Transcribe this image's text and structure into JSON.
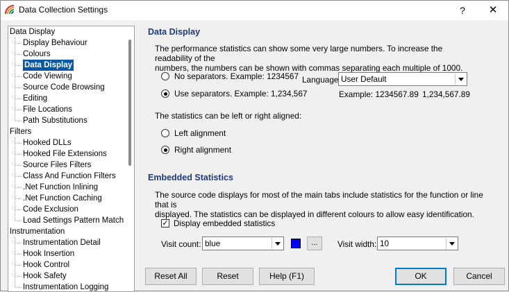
{
  "window": {
    "title": "Data Collection Settings",
    "help_glyph": "?",
    "close_glyph": "✕"
  },
  "tree": {
    "groups": [
      {
        "label": "Data Display",
        "children": [
          "Display Behaviour",
          "Colours",
          "Data Display",
          "Code Viewing",
          "Source Code Browsing",
          "Editing",
          "File Locations",
          "Path Substitutions"
        ]
      },
      {
        "label": "Filters",
        "children": [
          "Hooked DLLs",
          "Hooked File Extensions",
          "Source Files Filters",
          "Class And Function Filters",
          ".Net Function Inlining",
          ".Net Function Caching",
          "Code Exclusion",
          "Load Settings Pattern Match"
        ]
      },
      {
        "label": "Instrumentation",
        "children": [
          "Instrumentation Detail",
          "Hook Insertion",
          "Hook Control",
          "Hook Safety",
          "Instrumentation Logging"
        ]
      }
    ],
    "selected": "Data Display"
  },
  "data_display": {
    "heading": "Data Display",
    "description": "The performance statistics can show some very large numbers. To increase the readability of the numbers, the numbers can be shown with commas separating each multiple of 1000.",
    "description_line1": "The performance statistics can show some very large numbers. To increase the readability of the",
    "description_line2": "numbers, the numbers can be shown with commas separating each multiple of 1000.",
    "no_separators_label": "No separators. Example: 1234567",
    "use_separators_label": "Use separators. Example: 1,234,567",
    "separator_choice": "use_separators",
    "language_label": "Language:",
    "language_value": "User Default",
    "example_label": "Example:",
    "example_value_1": "1234567.89",
    "example_value_2": "1,234,567.89",
    "align_prompt": "The statistics can be left or right aligned:",
    "left_alignment_label": "Left alignment",
    "right_alignment_label": "Right alignment",
    "alignment_choice": "right"
  },
  "embedded_statistics": {
    "heading": "Embedded Statistics",
    "description_line1": "The source code displays for most of the main tabs include statistics for the function or line that is",
    "description_line2": "displayed. The statistics can be displayed in different colours to allow easy identification.",
    "display_checkbox_label": "Display embedded statistics",
    "display_checked": true,
    "check_glyph": "✓",
    "visit_count_label": "Visit count:",
    "visit_count_value": "blue",
    "visit_count_color": "#0000ff",
    "ellipsis_label": "...",
    "visit_width_label": "Visit width:",
    "visit_width_value": "10"
  },
  "buttons": {
    "reset_all": "Reset All",
    "reset": "Reset",
    "help": "Help (F1)",
    "ok": "OK",
    "cancel": "Cancel"
  },
  "colors": {
    "heading": "#1f3a7a",
    "selection": "#0a58a4",
    "accent_border": "#0078d7"
  }
}
